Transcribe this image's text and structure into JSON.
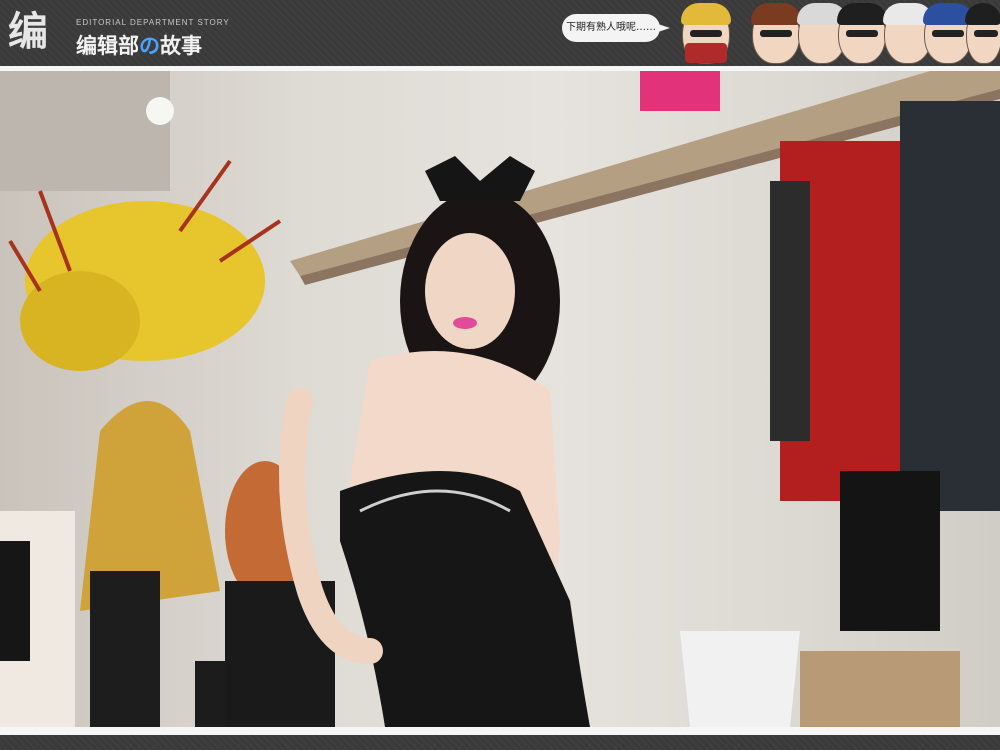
{
  "header": {
    "logo_mark": "编",
    "logo_subtitle": "EDITORIAL DEPARTMENT STORY",
    "logo_title_a": "编辑部",
    "logo_title_b": "の",
    "logo_title_c": "故事",
    "speech_bubble": "下期有熟人哦呢……"
  },
  "colors": {
    "bar": "#3a3a3a",
    "accent": "#4aa3ff",
    "frame": "#f6f6f6"
  },
  "photo": {
    "icon": "photo-backstage-woman-black-dress"
  }
}
